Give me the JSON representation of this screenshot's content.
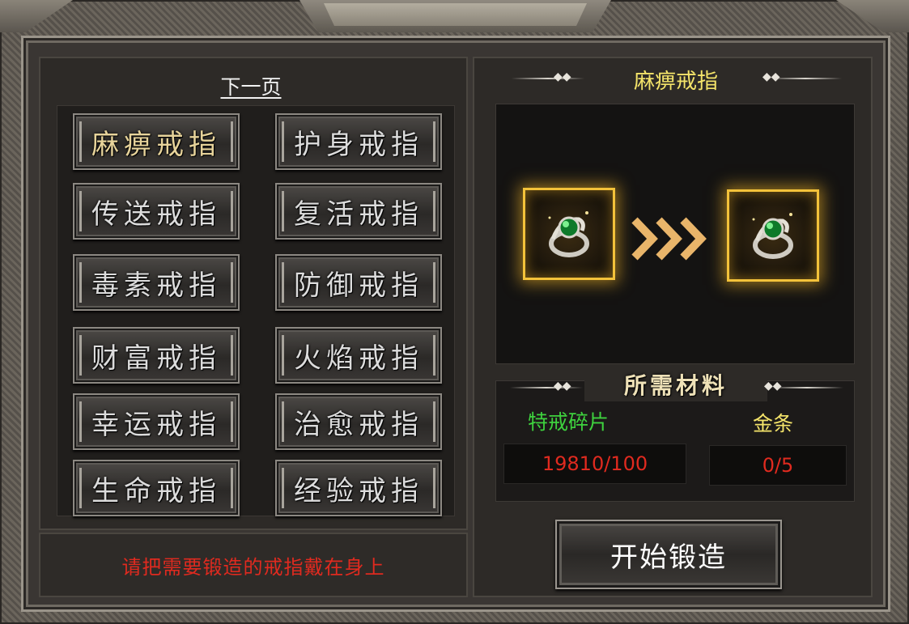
{
  "nav": {
    "next_page": "下一页"
  },
  "rings": [
    {
      "label": "麻痹戒指",
      "selected": true
    },
    {
      "label": "护身戒指"
    },
    {
      "label": "传送戒指"
    },
    {
      "label": "复活戒指"
    },
    {
      "label": "毒素戒指"
    },
    {
      "label": "防御戒指"
    },
    {
      "label": "财富戒指"
    },
    {
      "label": "火焰戒指"
    },
    {
      "label": "幸运戒指"
    },
    {
      "label": "治愈戒指"
    },
    {
      "label": "生命戒指"
    },
    {
      "label": "经验戒指"
    }
  ],
  "hint": "请把需要锻造的戒指戴在身上",
  "forge": {
    "title": "麻痹戒指",
    "source_icon": "green-gem-ring-icon",
    "result_icon": "green-gem-ring-icon",
    "arrow_icon": "triple-chevron-right-icon"
  },
  "materials": {
    "title": "所需材料",
    "items": [
      {
        "name": "特戒碎片",
        "count": "19810/100",
        "name_color": "#3ed23e"
      },
      {
        "name": "金条",
        "count": "0/5",
        "name_color": "#f4e46a"
      }
    ]
  },
  "actions": {
    "start_forge": "开始锻造"
  },
  "colors": {
    "title": "#f4e46a",
    "warning": "#e02a1f",
    "slot_glow": "#f3c23a"
  }
}
